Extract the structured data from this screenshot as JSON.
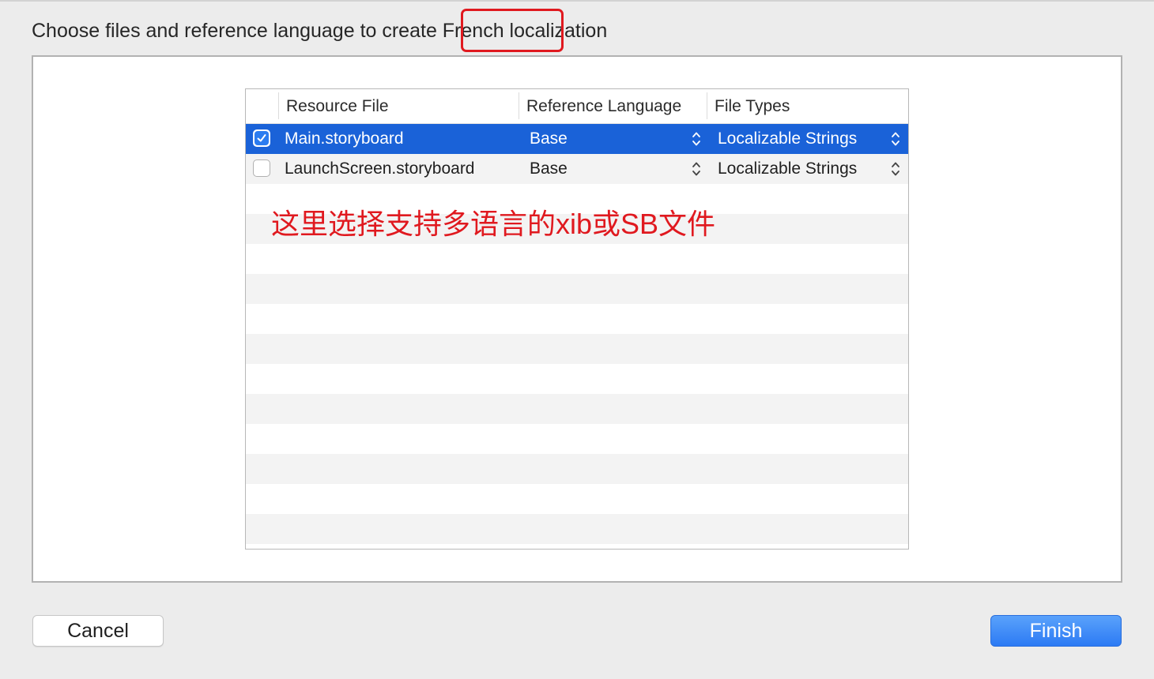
{
  "dialog": {
    "heading": "Choose files and reference language to create French localization"
  },
  "table": {
    "columns": [
      "Resource File",
      "Reference Language",
      "File Types"
    ],
    "rows": [
      {
        "checked": true,
        "file": "Main.storyboard",
        "language": "Base",
        "type": "Localizable Strings"
      },
      {
        "checked": false,
        "file": "LaunchScreen.storyboard",
        "language": "Base",
        "type": "Localizable Strings"
      }
    ]
  },
  "annotation": {
    "text": "这里选择支持多语言的xib或SB文件",
    "color": "#e0191f"
  },
  "buttons": {
    "cancel_label": "Cancel",
    "finish_label": "Finish"
  },
  "colors": {
    "selection": "#1a62d8",
    "accent": "#2c7af4",
    "highlight": "#e0191f"
  },
  "icons": {
    "checkbox": "checkbox-icon",
    "popup": "popup-stepper-icon"
  }
}
